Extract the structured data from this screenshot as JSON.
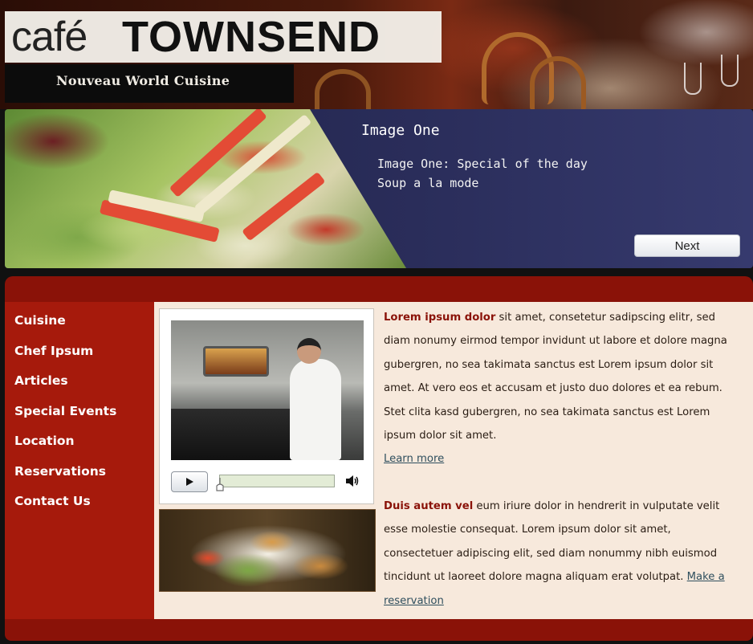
{
  "header": {
    "logo_cafe": "café",
    "logo_name": "TOWNSEND",
    "tagline": "Nouveau World Cuisine"
  },
  "slideshow": {
    "title": "Image One",
    "caption": "Image One: Special of the day\nSoup a la mode",
    "next_label": "Next"
  },
  "nav": {
    "items": [
      {
        "label": "Cuisine"
      },
      {
        "label": "Chef Ipsum"
      },
      {
        "label": "Articles"
      },
      {
        "label": "Special Events"
      },
      {
        "label": "Location"
      },
      {
        "label": "Reservations"
      },
      {
        "label": "Contact Us"
      }
    ]
  },
  "video": {
    "progress": 0,
    "icons": {
      "play": "play-icon",
      "volume": "volume-icon"
    }
  },
  "articles": [
    {
      "lead": "Lorem ipsum dolor",
      "body": " sit amet, consetetur sadipscing elitr, sed diam nonumy eirmod tempor invidunt ut labore et dolore magna gubergren, no sea takimata sanctus est Lorem ipsum dolor sit amet. At vero eos et accusam et justo duo dolores et ea rebum. Stet clita kasd gubergren, no sea takimata sanctus est Lorem ipsum dolor sit amet.",
      "link": "Learn more"
    },
    {
      "lead": "Duis autem vel",
      "body": " eum iriure dolor in hendrerit in vulputate velit esse molestie consequat. Lorem ipsum dolor sit amet, consectetuer adipiscing elit, sed diam nonummy nibh euismod tincidunt ut laoreet dolore magna aliquam erat volutpat. ",
      "link": "Make a reservation"
    }
  ],
  "colors": {
    "brand_red": "#a61a0c",
    "frame_dark_red": "#8a1208",
    "content_bg": "#f7e9dc",
    "slideshow_navy": "#2a2d5a"
  }
}
